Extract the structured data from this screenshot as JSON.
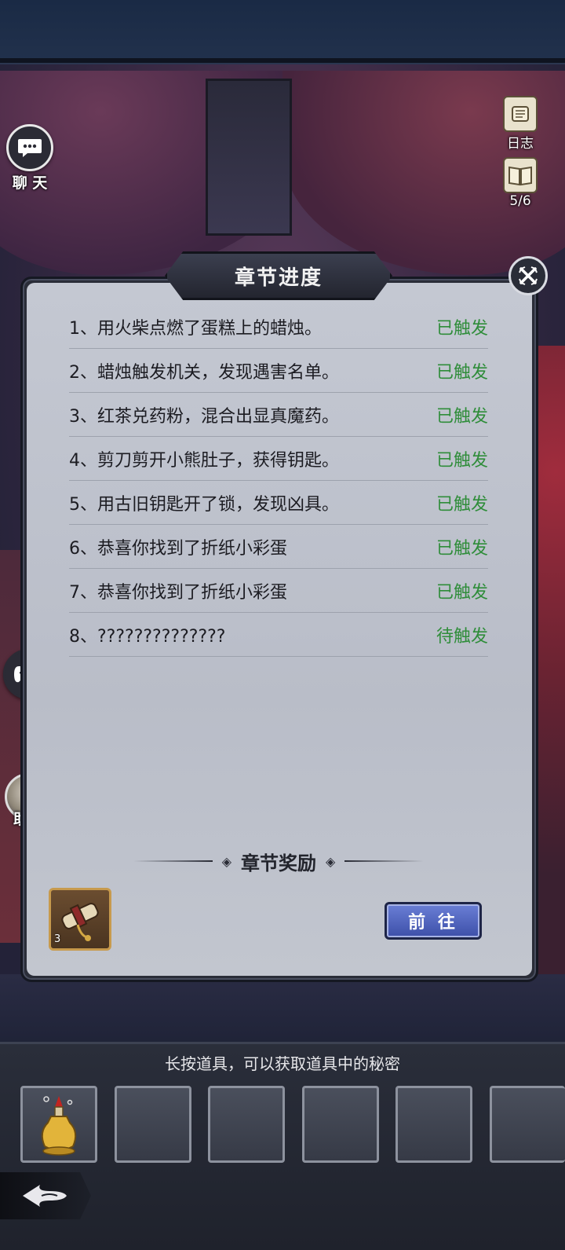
{
  "side_buttons": {
    "chat_label": "聊 天",
    "helper_label": "助手",
    "journal_label": "日志",
    "pages_label": "5/6"
  },
  "panel": {
    "title": "章节进度",
    "rows": [
      {
        "text": "1、用火柴点燃了蛋糕上的蜡烛。",
        "status": "已触发"
      },
      {
        "text": "2、蜡烛触发机关，发现遇害名单。",
        "status": "已触发"
      },
      {
        "text": "3、红茶兑药粉，混合出显真魔药。",
        "status": "已触发"
      },
      {
        "text": "4、剪刀剪开小熊肚子，获得钥匙。",
        "status": "已触发"
      },
      {
        "text": "5、用古旧钥匙开了锁，发现凶具。",
        "status": "已触发"
      },
      {
        "text": "6、恭喜你找到了折纸小彩蛋",
        "status": "已触发"
      },
      {
        "text": "7、恭喜你找到了折纸小彩蛋",
        "status": "已触发"
      },
      {
        "text": "8、??????????????",
        "status": "待触发"
      }
    ],
    "reward_title": "章节奖励",
    "reward_count": "3",
    "go_label": "前 往"
  },
  "inventory": {
    "hint": "长按道具，可以获取道具中的秘密"
  },
  "colors": {
    "triggered": "#2f8d3a",
    "button_blue": "#4f63c0"
  }
}
